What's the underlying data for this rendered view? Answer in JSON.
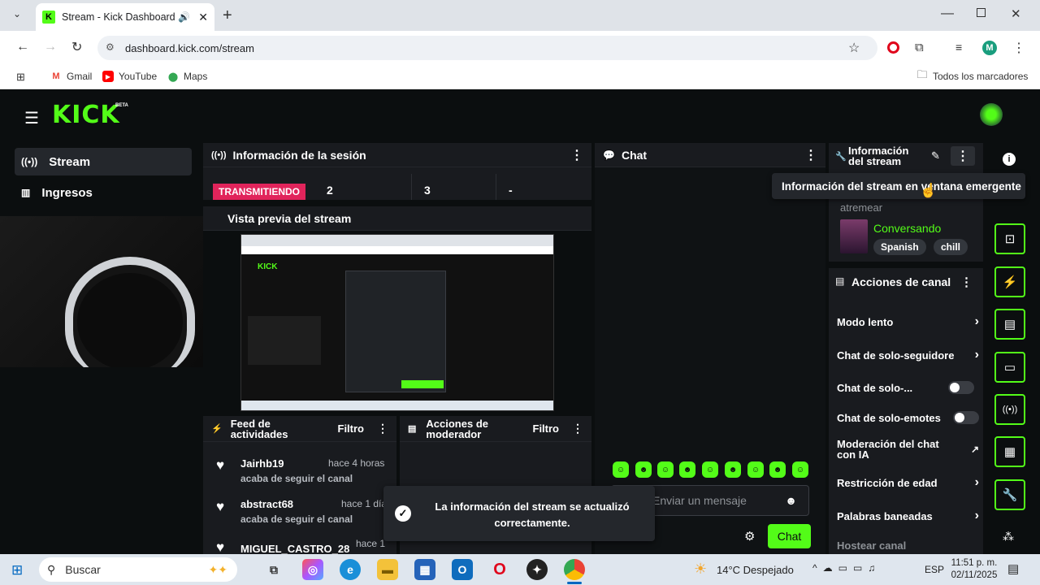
{
  "browser": {
    "tab_title": "Stream - Kick Dashboard",
    "url": "dashboard.kick.com/stream",
    "bookmarks": [
      "Gmail",
      "YouTube",
      "Maps"
    ],
    "all_bookmarks": "Todos los marcadores",
    "profile_initial": "M"
  },
  "header": {
    "logo": "KICK",
    "beta": "BETA"
  },
  "sidebar": {
    "items": [
      {
        "label": "Stream",
        "icon": "broadcast-icon"
      },
      {
        "label": "Ingresos",
        "icon": "chart-icon"
      }
    ]
  },
  "session": {
    "title": "Información de la sesión",
    "status": "TRANSMITIENDO",
    "stats": [
      "2",
      "3",
      "-"
    ]
  },
  "preview": {
    "title": "Vista previa del stream"
  },
  "feed": {
    "title": "Feed de actividades",
    "filter": "Filtro",
    "items": [
      {
        "name": "Jairhb19",
        "time": "hace 4 horas",
        "action": "acaba de seguir el canal"
      },
      {
        "name": "abstract68",
        "time": "hace 1 día",
        "action": "acaba de seguir el canal"
      },
      {
        "name": "MIGUEL_CASTRO_28",
        "time": "hace 1",
        "action": ""
      }
    ]
  },
  "mod_actions": {
    "title": "Acciones de moderador",
    "filter": "Filtro"
  },
  "chat": {
    "title": "Chat",
    "placeholder": "Enviar un mensaje",
    "send": "Chat"
  },
  "stream_info": {
    "title": "Información del stream",
    "tooltip": "Información del stream en ventana emergente",
    "partial": "atremear",
    "category": "Conversando",
    "tags": [
      "Spanish",
      "chill"
    ]
  },
  "channel_actions": {
    "title": "Acciones de canal",
    "items": [
      {
        "label": "Modo lento",
        "control": "arrow"
      },
      {
        "label": "Chat de solo-seguidore",
        "control": "arrow"
      },
      {
        "label": "Chat de solo-...",
        "control": "toggle"
      },
      {
        "label": "Chat de solo-emotes",
        "control": "toggle"
      },
      {
        "label": "Moderación del chat con IA",
        "control": "external"
      },
      {
        "label": "Restricción de edad",
        "control": "arrow"
      },
      {
        "label": "Palabras baneadas",
        "control": "arrow"
      },
      {
        "label": "Hostear canal",
        "control": "none"
      }
    ]
  },
  "toast": {
    "message": "La información del stream se actualizó correctamente."
  },
  "taskbar": {
    "search": "Buscar",
    "weather": "14°C  Despejado",
    "lang": "ESP",
    "time": "11:51 p. m.",
    "date": "02/11/2025"
  },
  "colors": {
    "accent": "#53fc18",
    "live": "#e1245b",
    "panel": "#191b1f",
    "bg": "#0b0e0f"
  }
}
